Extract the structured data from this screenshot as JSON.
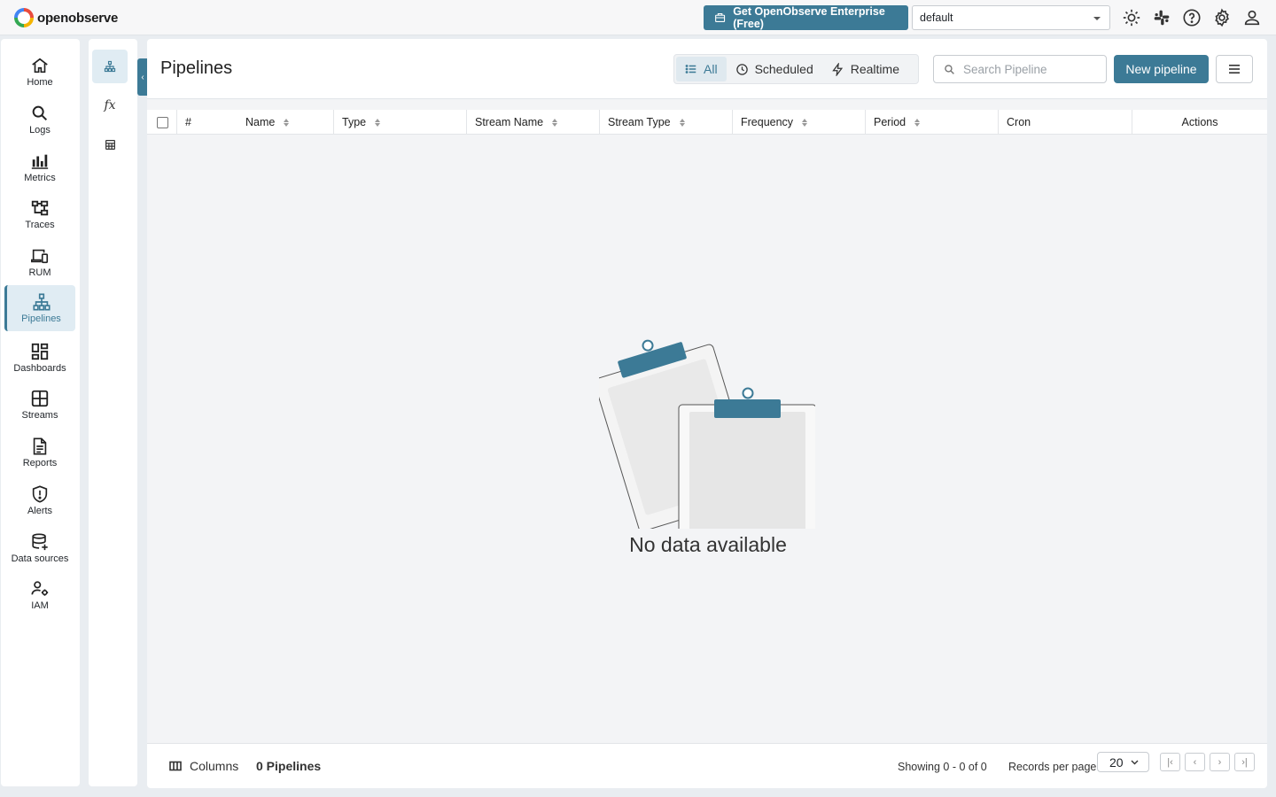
{
  "brand": {
    "name": "openobserve"
  },
  "header": {
    "enterprise_label": "Get OpenObserve Enterprise (Free)",
    "org_value": "default",
    "icons": [
      "theme-icon",
      "slack-icon",
      "help-icon",
      "settings-icon",
      "user-icon"
    ]
  },
  "nav": {
    "items": [
      {
        "label": "Home",
        "icon": "home-icon"
      },
      {
        "label": "Logs",
        "icon": "search-icon"
      },
      {
        "label": "Metrics",
        "icon": "bar-chart-icon"
      },
      {
        "label": "Traces",
        "icon": "traces-icon"
      },
      {
        "label": "RUM",
        "icon": "devices-icon"
      },
      {
        "label": "Pipelines",
        "icon": "pipeline-icon",
        "active": true
      },
      {
        "label": "Dashboards",
        "icon": "dashboard-icon"
      },
      {
        "label": "Streams",
        "icon": "streams-icon"
      },
      {
        "label": "Reports",
        "icon": "report-icon"
      },
      {
        "label": "Alerts",
        "icon": "alert-icon"
      },
      {
        "label": "Data sources",
        "icon": "database-icon"
      },
      {
        "label": "IAM",
        "icon": "iam-icon"
      }
    ]
  },
  "subnav": {
    "items": [
      {
        "icon": "pipeline-icon",
        "active": true
      },
      {
        "label": "fx",
        "icon": "function-icon"
      },
      {
        "icon": "table-icon"
      }
    ]
  },
  "page": {
    "title": "Pipelines",
    "tabs": [
      {
        "label": "All",
        "icon": "list-icon",
        "active": true
      },
      {
        "label": "Scheduled",
        "icon": "clock-icon"
      },
      {
        "label": "Realtime",
        "icon": "bolt-icon"
      }
    ],
    "search_placeholder": "Search Pipeline",
    "new_button": "New pipeline"
  },
  "table": {
    "columns": [
      {
        "label": "#",
        "sortable": false
      },
      {
        "label": "Name",
        "sortable": true
      },
      {
        "label": "Type",
        "sortable": true
      },
      {
        "label": "Stream Name",
        "sortable": true
      },
      {
        "label": "Stream Type",
        "sortable": true
      },
      {
        "label": "Frequency",
        "sortable": true
      },
      {
        "label": "Period",
        "sortable": true
      },
      {
        "label": "Cron",
        "sortable": false
      },
      {
        "label": "Actions",
        "sortable": false
      }
    ],
    "rows": [],
    "empty_text": "No data available"
  },
  "footer": {
    "columns_label": "Columns",
    "count_label": "0 Pipelines",
    "showing": "Showing 0 - 0 of 0",
    "records_per_page_label": "Records per page",
    "records_per_page": "20"
  },
  "colors": {
    "accent": "#3c7a96",
    "active_bg": "#e0ecf3",
    "background": "#e9edf1"
  }
}
